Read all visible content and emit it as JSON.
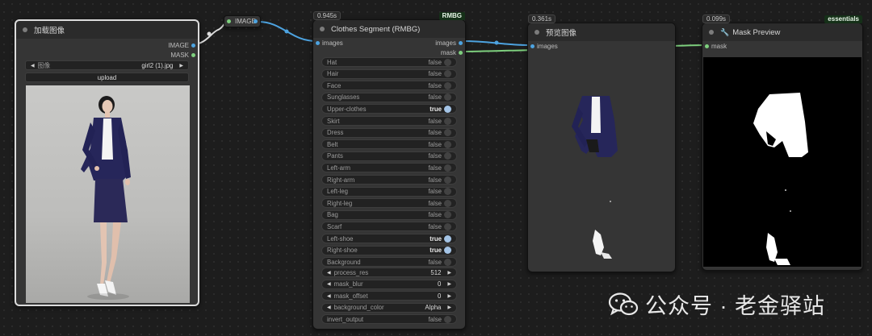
{
  "load_image_node": {
    "title": "加载图像",
    "outputs": [
      "IMAGE",
      "MASK"
    ],
    "image_label": "图像",
    "image_value": "girl2 (1).jpg",
    "upload_label": "upload"
  },
  "reroute_node": {
    "label": "IMAGE"
  },
  "clothes_node": {
    "time": "0.945s",
    "tag": "RMBG",
    "title": "Clothes Segment (RMBG)",
    "input": "images",
    "outputs": [
      "images",
      "mask"
    ],
    "toggles": [
      {
        "label": "Hat",
        "value": "false"
      },
      {
        "label": "Hair",
        "value": "false"
      },
      {
        "label": "Face",
        "value": "false"
      },
      {
        "label": "Sunglasses",
        "value": "false"
      },
      {
        "label": "Upper-clothes",
        "value": "true"
      },
      {
        "label": "Skirt",
        "value": "false"
      },
      {
        "label": "Dress",
        "value": "false"
      },
      {
        "label": "Belt",
        "value": "false"
      },
      {
        "label": "Pants",
        "value": "false"
      },
      {
        "label": "Left-arm",
        "value": "false"
      },
      {
        "label": "Right-arm",
        "value": "false"
      },
      {
        "label": "Left-leg",
        "value": "false"
      },
      {
        "label": "Right-leg",
        "value": "false"
      },
      {
        "label": "Bag",
        "value": "false"
      },
      {
        "label": "Scarf",
        "value": "false"
      },
      {
        "label": "Left-shoe",
        "value": "true"
      },
      {
        "label": "Right-shoe",
        "value": "true"
      },
      {
        "label": "Background",
        "value": "false"
      }
    ],
    "numbers": [
      {
        "label": "process_res",
        "value": "512"
      },
      {
        "label": "mask_blur",
        "value": "0"
      },
      {
        "label": "mask_offset",
        "value": "0"
      },
      {
        "label": "background_color",
        "value": "Alpha"
      }
    ],
    "invert": {
      "label": "invert_output",
      "value": "false"
    }
  },
  "preview_node": {
    "time": "0.361s",
    "title": "预览图像",
    "input": "images"
  },
  "mask_node": {
    "time": "0.099s",
    "tag": "essentials",
    "title": "Mask Preview",
    "input": "mask"
  },
  "watermark": "公众号 · 老金驿站",
  "colors": {
    "image_port": "#4da3e0",
    "mask_port": "#7ed07e",
    "node_bg": "#353535",
    "canvas_bg": "#1d1d1d"
  }
}
